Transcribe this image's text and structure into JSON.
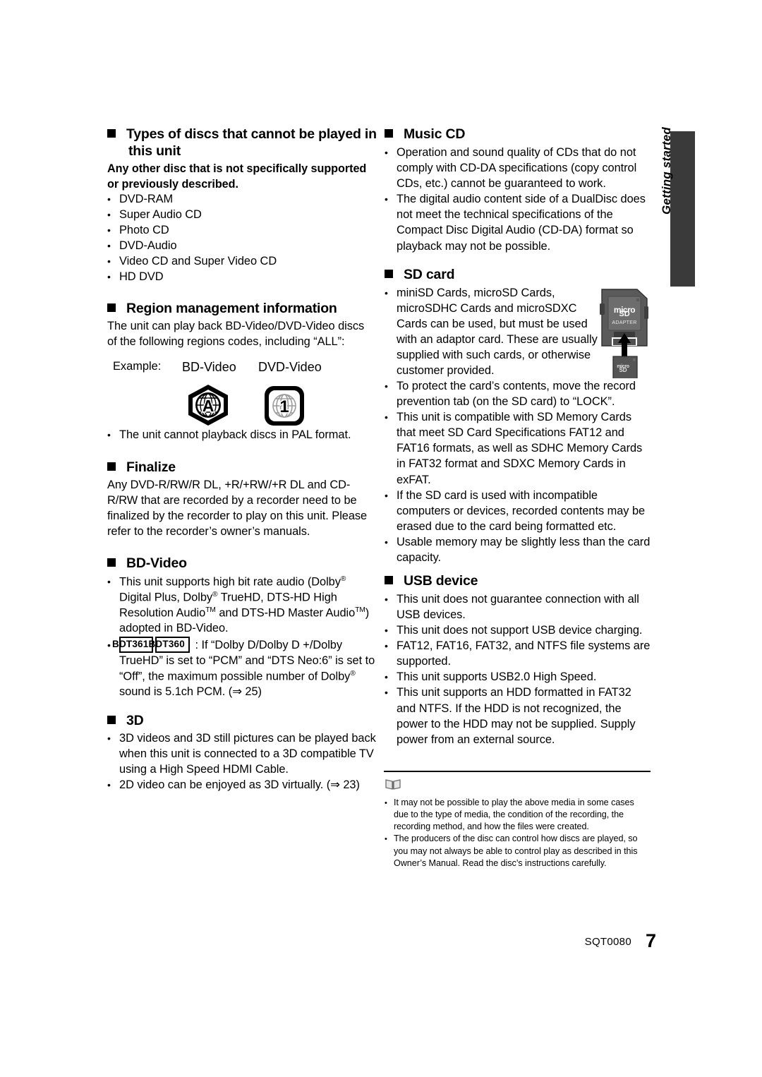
{
  "side_tab": {
    "label": "Getting started",
    "bar_color": "#3a3a3a"
  },
  "left_column": {
    "section_cannot_play": {
      "heading": "Types of discs that cannot be played in this unit",
      "intro": "Any other disc that is not specifically supported or previously described.",
      "items": [
        "DVD-RAM",
        "Super Audio CD",
        "Photo CD",
        "DVD-Audio",
        "Video CD and Super Video CD",
        "HD DVD"
      ]
    },
    "section_region": {
      "heading": "Region management information",
      "paragraph": "The unit can play back BD-Video/DVD-Video discs of the following regions codes, including “ALL”:",
      "example_label": "Example:",
      "example_bd_label": "BD-Video",
      "example_dvd_label": "DVD-Video",
      "bd_region_code": "A",
      "dvd_region_code": "1",
      "note": "The unit cannot playback discs in PAL format."
    },
    "section_finalize": {
      "heading": "Finalize",
      "paragraph": "Any DVD-R/RW/R DL, +R/+RW/+R DL and CD-R/RW that are recorded by a recorder need to be finalized by the recorder to play on this unit. Please refer to the recorder’s owner’s manuals."
    },
    "section_bdvideo": {
      "heading": "BD-Video",
      "bullet1_a": "This unit supports high bit rate audio (Dolby",
      "bullet1_b": "Digital Plus, Dolby",
      "bullet1_c": "TrueHD, DTS-HD High Resolution Audio",
      "bullet1_d": "and DTS-HD Master Audio",
      "bullet1_e": ") adopted in BD-Video.",
      "badge1": "BDT361",
      "badge2": "BDT360",
      "bullet2_a": ": If “Dolby D/Dolby D +/Dolby TrueHD” is set to “PCM” and “DTS Neo:6” is set to “Off”, the maximum possible number of Dolby",
      "bullet2_b": "sound is 5.1ch PCM. (⇒ 25)"
    },
    "section_3d": {
      "heading": "3D",
      "items": [
        "3D videos and 3D still pictures can be played back when this unit is connected to a 3D compatible TV using a High Speed HDMI Cable.",
        "2D video can be enjoyed as 3D virtually. (⇒ 23)"
      ]
    }
  },
  "right_column": {
    "section_music_cd": {
      "heading": "Music CD",
      "items": [
        "Operation and sound quality of CDs that do not comply with CD-DA specifications (copy control CDs, etc.) cannot be guaranteed to work.",
        "The digital audio content side of a DualDisc does not meet the technical specifications of the Compact Disc Digital Audio (CD-DA) format so playback may not be possible."
      ]
    },
    "section_sd_card": {
      "heading": "SD card",
      "items": [
        "miniSD Cards, microSD Cards, microSDHC Cards and microSDXC Cards can be used, but must be used with an adaptor card. These are usually supplied with such cards, or otherwise customer provided.",
        "To protect the card’s contents, move the record prevention tab (on the SD card) to “LOCK”.",
        "This unit is compatible with SD Memory Cards that meet SD Card Specifications FAT12 and FAT16 formats, as well as SDHC Memory Cards in FAT32 format and SDXC Memory Cards in exFAT.",
        "If the SD card is used with incompatible computers or devices, recorded contents may be erased due to the card being formatted etc.",
        "Usable memory may be slightly less than the card capacity."
      ],
      "image": {
        "adapter_brand": "micro",
        "adapter_sd": "SD",
        "adapter_label": "ADAPTER"
      }
    },
    "section_usb": {
      "heading": "USB device",
      "items": [
        "This unit does not guarantee connection with all USB devices.",
        "This unit does not support USB device charging.",
        "FAT12, FAT16, FAT32, and NTFS file systems are supported.",
        "This unit supports USB2.0 High Speed.",
        "This unit supports an HDD formatted in FAT32 and NTFS. If the HDD is not recognized, the power to the HDD may not be supplied. Supply power from an external source."
      ]
    },
    "notes": {
      "items": [
        "It may not be possible to play the above media in some cases due to the type of media, the condition of the recording, the recording method, and how the files were created.",
        "The producers of the disc can control how discs are played, so you may not always be able to control play as described in this Owner’s Manual. Read the disc’s instructions carefully."
      ]
    }
  },
  "footer": {
    "document_code": "SQT0080",
    "page_number": "7"
  }
}
